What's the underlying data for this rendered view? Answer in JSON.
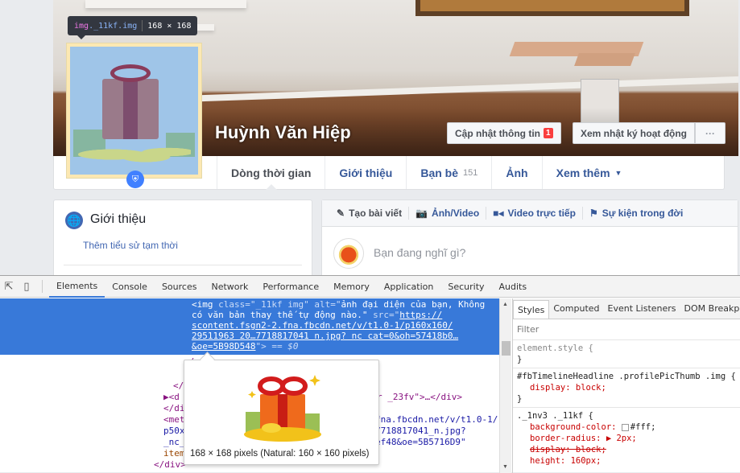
{
  "facebook": {
    "profile_name": "Huỳnh Văn Hiệp",
    "inspect_tooltip": {
      "tag": "img",
      "classes": "._11kf.img",
      "size": "168 × 168"
    },
    "buttons": {
      "update_info": "Cập nhật thông tin",
      "update_info_badge": "1",
      "activity_log": "Xem nhật ký hoạt động",
      "more": "···"
    },
    "nav_tabs": [
      {
        "label": "Dòng thời gian",
        "active": true
      },
      {
        "label": "Giới thiệu"
      },
      {
        "label": "Bạn bè",
        "count": "151"
      },
      {
        "label": "Ảnh"
      },
      {
        "label": "Xem thêm",
        "caret": "▼"
      }
    ],
    "intro": {
      "title": "Giới thiệu",
      "link": "Thêm tiểu sử tạm thời"
    },
    "composer": {
      "tabs": [
        {
          "icon": "pencil-icon",
          "label": "Tạo bài viết"
        },
        {
          "icon": "camera-icon",
          "label": "Ảnh/Video"
        },
        {
          "icon": "video-camera-icon",
          "label": "Video trực tiếp"
        },
        {
          "icon": "flag-icon",
          "label": "Sự kiện trong đời"
        }
      ],
      "placeholder": "Bạn đang nghĩ gì?"
    }
  },
  "devtools": {
    "tabs": [
      "Elements",
      "Console",
      "Sources",
      "Network",
      "Performance",
      "Memory",
      "Application",
      "Security",
      "Audits"
    ],
    "active_tab": "Elements",
    "selected_node": {
      "line1_tag": "<img ",
      "line1_attr": "class=\"_11kf img\" alt=\"",
      "line1_val": "ảnh đại diện của bạn, Không",
      "line2_val": "có văn bản thay thế tự động nào.\"",
      "line2_attr": " src=\"",
      "line2_link": "https://",
      "line3": "scontent.fsgn2-2.fna.fbcdn.net/v/t1.0-1/p160x160/",
      "line4": "29511963 20…7718817041 n.jpg? nc cat=0&oh=57418b0…",
      "line5_link": "&oe=5B98D548",
      "line5_end": "\">",
      "console_ref": " == $0"
    },
    "code_lines": [
      {
        "text": "</a>"
      },
      {
        "text": "</div>"
      },
      {
        "text": "▶<div class=\"…r _23fv\">…</div>"
      },
      {
        "text": "</div>"
      },
      {
        "text": "<meta … fna.fbcdn.net/v/t1.0-1/"
      },
      {
        "text": "p50x… 7718817041_n.jpg?"
      },
      {
        "text": "_nc_… ef48&oe=5B5716D9\""
      },
      {
        "text": "item…"
      },
      {
        "text": "</div>"
      }
    ],
    "right_fragments": {
      "l1": "r _23fv\">…</div>",
      "l2": "fna.fbcdn.net/v/t1.0-1/",
      "l3": "7718817041_n.jpg?",
      "l4": "ef48&oe=5B5716D9\""
    },
    "left_fragments": {
      "a": "</",
      "b": "▶<d",
      "c": "</di",
      "d": "<met",
      "e": "p50x",
      "f": "_nc_",
      "g": "item",
      "h": "</div>",
      "i": "</a>"
    },
    "image_preview_caption": "168 × 168 pixels (Natural: 160 × 160 pixels)",
    "sidebar": {
      "tabs": [
        "Styles",
        "Computed",
        "Event Listeners",
        "DOM Breakpoints"
      ],
      "active_tab": "Styles",
      "filter_placeholder": "Filter",
      "rules": [
        {
          "selector": "element.style {",
          "props": [],
          "close": "}"
        },
        {
          "selector": "#fbTimelineHeadline .profilePicThumb .img {",
          "props": [
            {
              "text": "display: block;"
            }
          ],
          "close": "}"
        },
        {
          "selector": "._1nv3 ._11kf {",
          "props": [
            {
              "text": "background-color: ",
              "swatch": "#fff",
              "value": "#fff;"
            },
            {
              "text": "border-radius: ▶ 2px;"
            },
            {
              "text": "display: block;",
              "struck": true
            },
            {
              "text": "height: 160px;"
            }
          ]
        }
      ]
    }
  }
}
